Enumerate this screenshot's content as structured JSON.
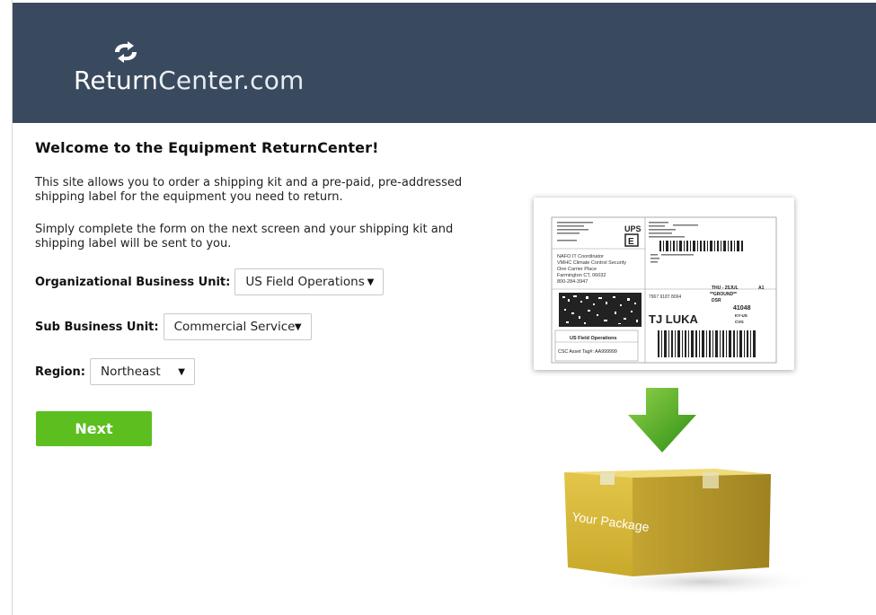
{
  "header": {
    "logo_text_bold": "Return",
    "logo_text_light": "Center.com",
    "bg_color": "#3a4a5e"
  },
  "main": {
    "welcome": "Welcome to the Equipment ReturnCenter!",
    "para1": "This site allows you to order a shipping kit and a pre-paid, pre-addressed shipping label for the equipment you need to return.",
    "para2": "Simply complete the form on the next screen and your shipping kit and shipping label will be sent to you.",
    "org_unit": {
      "label": "Organizational Business Unit:",
      "value": "US Field Operations"
    },
    "sub_unit": {
      "label": "Sub Business Unit:",
      "value": "Commercial Service"
    },
    "region": {
      "label": "Region:",
      "value": "Northeast"
    },
    "next_label": "Next"
  },
  "label_image": {
    "carrier": "UPS",
    "service_letter": "E",
    "address_lines": [
      "NAFO IT Coordinator",
      "VMHC Climate Control Security",
      "One Carrier Place",
      "Farmington CT, 06032",
      "800-284-3947"
    ],
    "ship_date": "THU - 25JUL",
    "priority": "A1",
    "ground": "**GROUND**",
    "dsr": "DSR",
    "tracking_short": "7967 9187 8064",
    "dest_code": "41048",
    "dest_state": "KY-US",
    "airport": "CVG",
    "dest_name": "TJ LUKA",
    "box_title": "US Field Operations",
    "asset_tag": "CSC Asset Tag#: AA999999"
  },
  "package_image": {
    "text": "Your Package"
  },
  "colors": {
    "accent_green": "#5cbf1f",
    "arrow_green": "#4caa1e",
    "box_yellow": "#d9bd3a"
  }
}
